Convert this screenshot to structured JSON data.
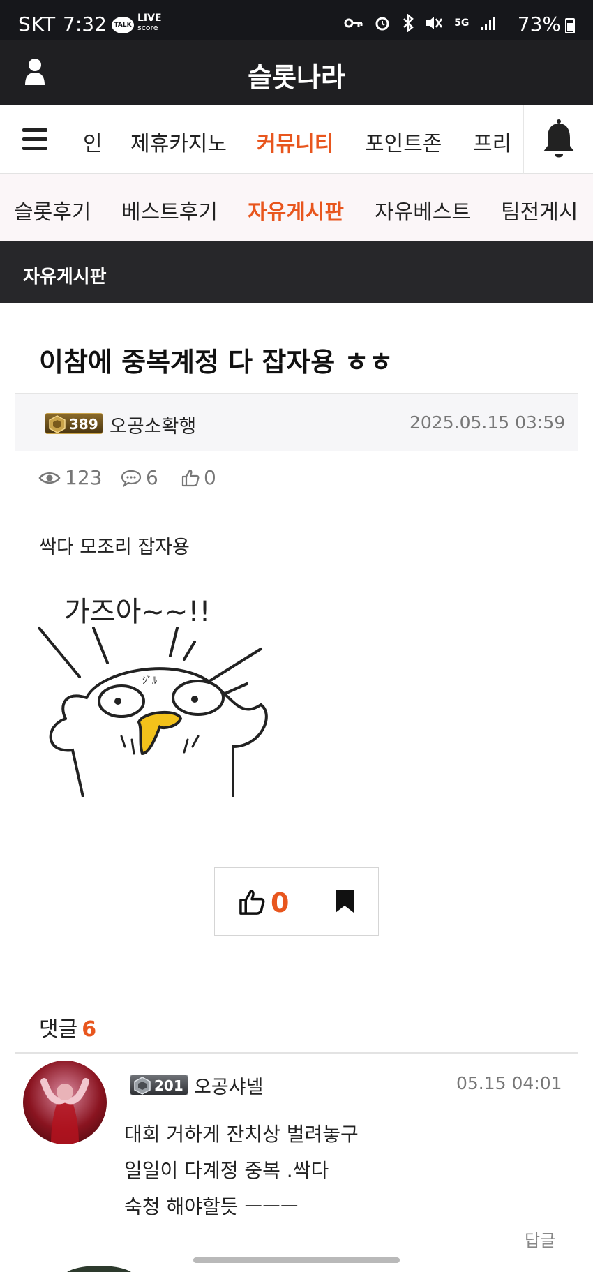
{
  "status_bar": {
    "carrier": "SKT",
    "time": "7:32",
    "talk_badge": "TALK",
    "live_label": "LIVE",
    "live_sub": "score",
    "network": "5G",
    "battery": "73%"
  },
  "header": {
    "title": "슬롯나라",
    "user_icon": "user-icon"
  },
  "main_nav": {
    "items": [
      {
        "label": "인",
        "active": false
      },
      {
        "label": "제휴카지노",
        "active": false
      },
      {
        "label": "커뮤니티",
        "active": true
      },
      {
        "label": "포인트존",
        "active": false
      },
      {
        "label": "프리",
        "active": false
      }
    ],
    "menu_icon": "hamburger-menu-icon",
    "bell_icon": "bell-icon"
  },
  "sub_nav": {
    "items": [
      {
        "label": "슬롯후기",
        "active": false
      },
      {
        "label": "베스트후기",
        "active": false
      },
      {
        "label": "자유게시판",
        "active": true
      },
      {
        "label": "자유베스트",
        "active": false
      },
      {
        "label": "팀전게시",
        "active": false
      }
    ]
  },
  "board": {
    "title": "자유게시판"
  },
  "post": {
    "title": "이참에 중복계정 다 잡자용 ㅎㅎ",
    "author_level": "389",
    "author": "오공소확행",
    "date": "2025.05.15 03:59",
    "views": "123",
    "comments": "6",
    "likes": "0",
    "body": "싹다 모조리 잡자용",
    "sticker_text": "가즈아~~!!",
    "sticker_marks": "ｼﾞﾙ",
    "like_count": "0"
  },
  "comments_section": {
    "label": "댓글",
    "count": "6",
    "items": [
      {
        "level": "201",
        "author": "오공샤넬",
        "date": "05.15 04:01",
        "lines": [
          "대회 거하게 잔치상 벌려놓구",
          "일일이 다계정 중복 .싹다",
          "숙청 해야할듯 ㅡㅡㅡ"
        ],
        "reply_label": "답글"
      }
    ]
  },
  "colors": {
    "accent": "#e8561e",
    "header_bg": "#1f1f22",
    "subnav_bg": "#fbf6f8"
  }
}
